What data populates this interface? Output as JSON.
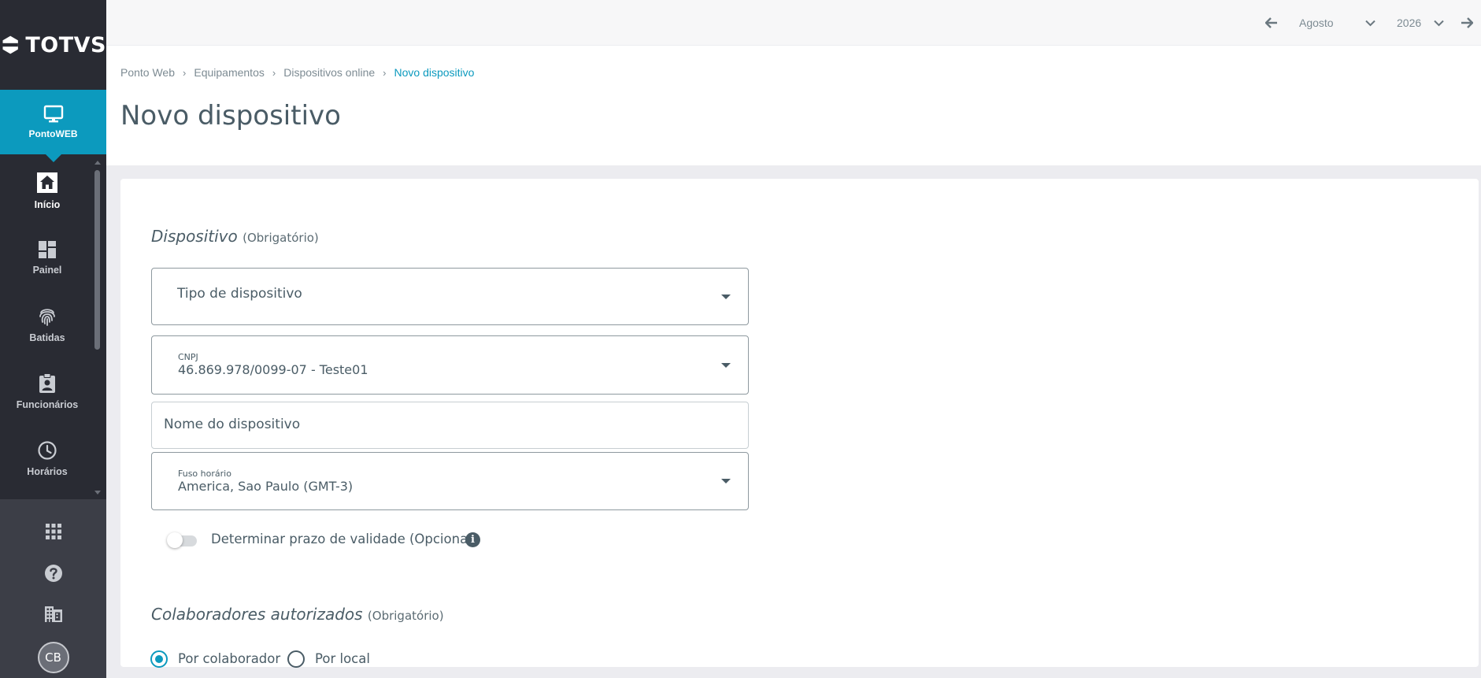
{
  "brand": {
    "logo_text": "TOTVS",
    "product_label": "PontoWEB"
  },
  "sidebar": {
    "items": [
      {
        "label": "Início",
        "icon": "home-icon",
        "active": true
      },
      {
        "label": "Painel",
        "icon": "dashboard-icon",
        "active": false
      },
      {
        "label": "Batidas",
        "icon": "fingerprint-icon",
        "active": false
      },
      {
        "label": "Funcionários",
        "icon": "badge-icon",
        "active": false
      },
      {
        "label": "Horários",
        "icon": "clock-icon",
        "active": false
      }
    ],
    "tools": [
      "apps-grid-icon",
      "help-icon",
      "building-icon"
    ],
    "avatar_initials": "CB"
  },
  "topbar": {
    "month": "Agosto",
    "year": "2026"
  },
  "breadcrumb": {
    "items": [
      "Ponto Web",
      "Equipamentos",
      "Dispositivos online"
    ],
    "current": "Novo dispositivo"
  },
  "page": {
    "title": "Novo dispositivo"
  },
  "form": {
    "device_section": {
      "title": "Dispositivo",
      "suffix": "(Obrigatório)"
    },
    "device_type": {
      "label": "Tipo de dispositivo"
    },
    "cnpj": {
      "label": "CNPJ",
      "value": "46.869.978/0099-07 - Teste01"
    },
    "device_name": {
      "placeholder": "Nome do dispositivo"
    },
    "timezone": {
      "label": "Fuso horário",
      "value": "America, Sao Paulo (GMT-3)"
    },
    "validity_toggle": {
      "label": "Determinar prazo de validade (Opcional)",
      "on": false
    },
    "collaborators_section": {
      "title": "Colaboradores autorizados",
      "suffix": "(Obrigatório)"
    },
    "collaborators_mode": {
      "options": [
        "Por colaborador",
        "Por local"
      ],
      "selected": "Por colaborador"
    }
  },
  "colors": {
    "accent": "#0c9abe",
    "sidebar_bg": "#292b33",
    "text": "#4a5c66"
  }
}
